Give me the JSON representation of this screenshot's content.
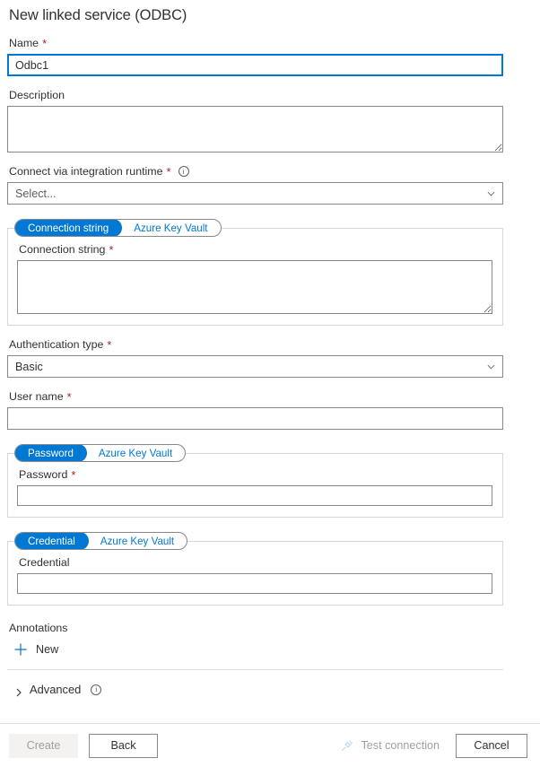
{
  "title": "New linked service (ODBC)",
  "fields": {
    "name": {
      "label": "Name",
      "required": "*",
      "value": "Odbc1"
    },
    "description": {
      "label": "Description",
      "value": ""
    },
    "integration_runtime": {
      "label": "Connect via integration runtime",
      "required": "*",
      "value": "Select...",
      "info_icon": "info-icon"
    },
    "auth_type": {
      "label": "Authentication type",
      "required": "*",
      "value": "Basic"
    },
    "user_name": {
      "label": "User name",
      "required": "*",
      "value": ""
    }
  },
  "connection_string_toggle": {
    "active": "Connection string",
    "inactive": "Azure Key Vault"
  },
  "connection_string_panel": {
    "label": "Connection string",
    "required": "*",
    "value": ""
  },
  "password_toggle": {
    "active": "Password",
    "inactive": "Azure Key Vault"
  },
  "password_panel": {
    "label": "Password",
    "required": "*",
    "value": ""
  },
  "credential_toggle": {
    "active": "Credential",
    "inactive": "Azure Key Vault"
  },
  "credential_panel": {
    "label": "Credential",
    "value": ""
  },
  "annotations": {
    "label": "Annotations",
    "new_label": "New",
    "plus_icon": "plus-icon"
  },
  "advanced": {
    "label": "Advanced",
    "chevron_icon": "chevron-right-icon",
    "info_icon": "info-icon"
  },
  "footer": {
    "create_label": "Create",
    "back_label": "Back",
    "test_connection_label": "Test connection",
    "test_connection_icon": "plug-icon",
    "cancel_label": "Cancel"
  },
  "colors": {
    "accent": "#0078d4",
    "required": "#a4262c",
    "disabled_text": "#a19f9d",
    "border": "#8a8886"
  }
}
